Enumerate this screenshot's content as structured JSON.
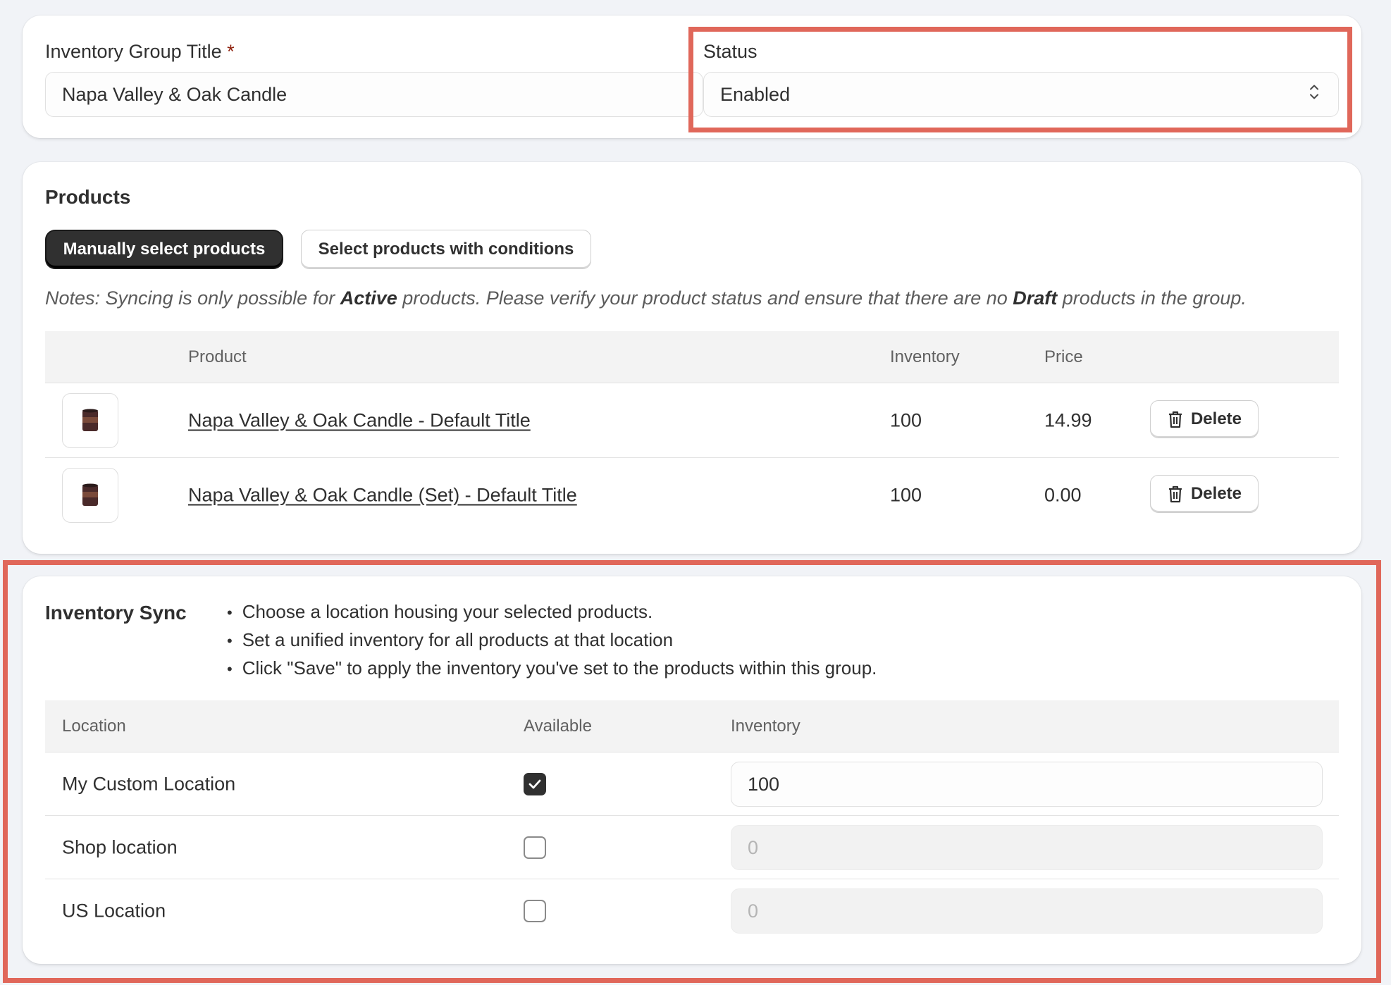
{
  "group": {
    "title_label": "Inventory Group Title",
    "required_mark": "*",
    "title_value": "Napa Valley & Oak Candle",
    "status_label": "Status",
    "status_value": "Enabled"
  },
  "products": {
    "heading": "Products",
    "manual_button": "Manually select products",
    "conditions_button": "Select products with conditions",
    "notes": {
      "prefix": "Notes: Syncing is only possible for ",
      "active": "Active",
      "middle": " products. Please verify your product status and ensure that there are no ",
      "draft": "Draft",
      "suffix": " products in the group."
    },
    "columns": {
      "product": "Product",
      "inventory": "Inventory",
      "price": "Price"
    },
    "rows": [
      {
        "name": "Napa Valley & Oak Candle - Default Title",
        "inventory": "100",
        "price": "14.99",
        "delete": "Delete"
      },
      {
        "name": "Napa Valley & Oak Candle (Set) - Default Title",
        "inventory": "100",
        "price": "0.00",
        "delete": "Delete"
      }
    ]
  },
  "sync": {
    "heading": "Inventory Sync",
    "bullets": [
      "Choose a location housing your selected products.",
      "Set a unified inventory for all products at that location",
      "Click \"Save\" to apply the inventory you've set to the products within this group."
    ],
    "columns": {
      "location": "Location",
      "available": "Available",
      "inventory": "Inventory"
    },
    "rows": [
      {
        "location": "My Custom Location",
        "available": true,
        "inventory": "100"
      },
      {
        "location": "Shop location",
        "available": false,
        "inventory": "0"
      },
      {
        "location": "US Location",
        "available": false,
        "inventory": "0"
      }
    ]
  },
  "colors": {
    "highlight": "#e0675a",
    "primary_button": "#303030",
    "required": "#8e1f0b"
  }
}
